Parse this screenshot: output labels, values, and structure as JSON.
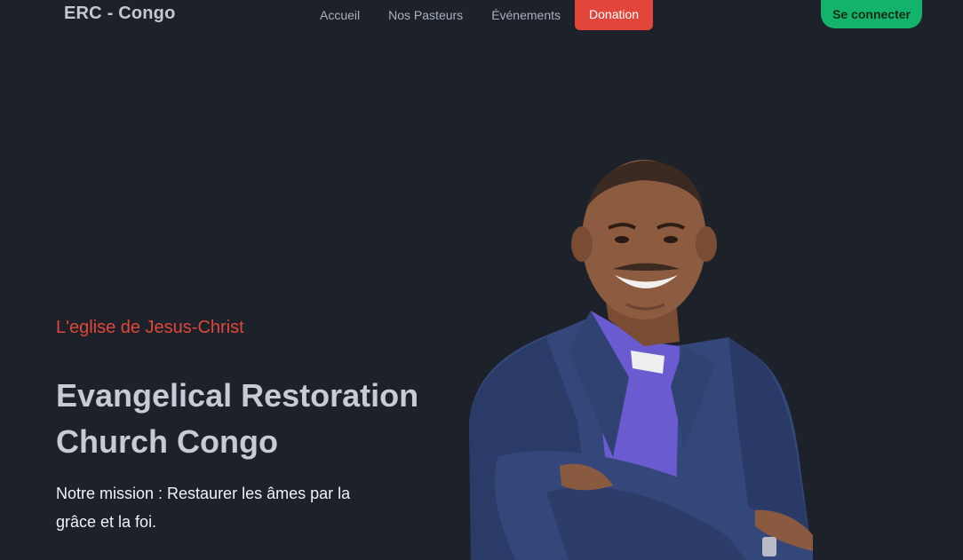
{
  "header": {
    "brand": "ERC - Congo",
    "nav": {
      "home": "Accueil",
      "pastors": "Nos Pasteurs",
      "events": "Événements",
      "donation": "Donation"
    },
    "login": "Se connecter"
  },
  "hero": {
    "tagline": "L'eglise de Jesus-Christ",
    "title": "Evangelical Restoration Church Congo",
    "mission": "Notre mission : Restaurer les âmes par la grâce et la foi."
  },
  "colors": {
    "background": "#1d2129",
    "accent_red": "#e2463a",
    "accent_green": "#14b36c"
  }
}
